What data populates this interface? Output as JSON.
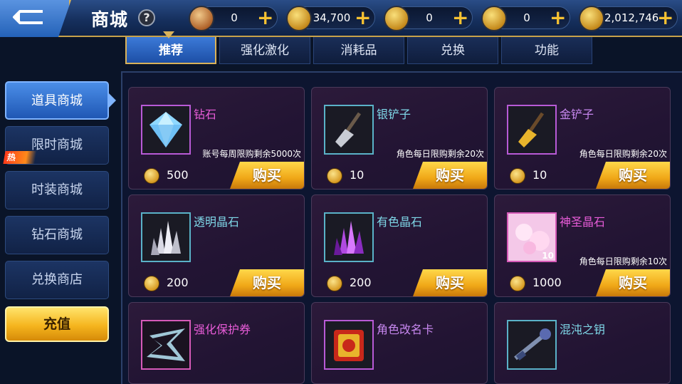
{
  "header": {
    "title": "商城",
    "help": "?",
    "currencies": [
      {
        "icon": "scroll-icon",
        "value": "0"
      },
      {
        "icon": "gold-coin-icon",
        "value": "34,700"
      },
      {
        "icon": "lock-coin-icon",
        "value": "0"
      },
      {
        "icon": "bronze-coin-icon",
        "value": "0"
      },
      {
        "icon": "gold-lock-coin-icon",
        "value": "2,012,746"
      }
    ],
    "plus": "+"
  },
  "tabs": [
    {
      "label": "推荐",
      "active": true
    },
    {
      "label": "强化激化"
    },
    {
      "label": "消耗品"
    },
    {
      "label": "兑换"
    },
    {
      "label": "功能"
    }
  ],
  "sidebar": {
    "items": [
      {
        "label": "道具商城",
        "active": true
      },
      {
        "label": "限时商城"
      },
      {
        "label": "时装商城"
      },
      {
        "label": "钻石商城"
      },
      {
        "label": "兑换商店"
      }
    ],
    "hot_badge": "热",
    "recharge": "充值"
  },
  "buy_label": "购买",
  "items": [
    {
      "name": "钻石",
      "limit": "账号每周限购剩余5000次",
      "price": "500",
      "color": "pink"
    },
    {
      "name": "银铲子",
      "limit": "角色每日限购剩余20次",
      "price": "10",
      "color": "cyan"
    },
    {
      "name": "金铲子",
      "limit": "角色每日限购剩余20次",
      "price": "10",
      "color": "violet"
    },
    {
      "name": "透明晶石",
      "limit": "",
      "price": "200",
      "color": "cyan"
    },
    {
      "name": "有色晶石",
      "limit": "",
      "price": "200",
      "color": "cyan"
    },
    {
      "name": "神圣晶石",
      "limit": "角色每日限购剩余10次",
      "price": "1000",
      "color": "pink",
      "count": "10"
    },
    {
      "name": "强化保护券",
      "limit": "",
      "price": "",
      "color": "pink"
    },
    {
      "name": "角色改名卡",
      "limit": "",
      "price": "",
      "color": "violet"
    },
    {
      "name": "混沌之钥",
      "limit": "",
      "price": "",
      "color": "cyan"
    }
  ]
}
